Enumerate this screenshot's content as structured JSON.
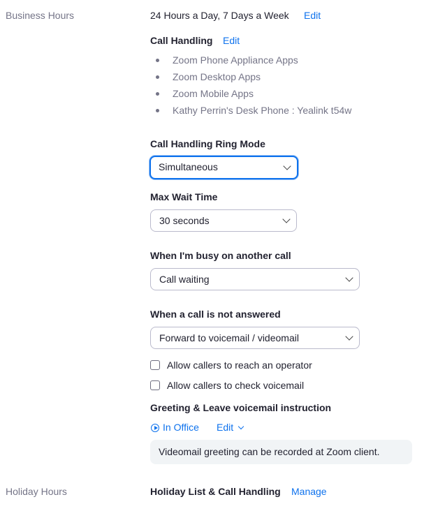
{
  "business_hours": {
    "section_label": "Business Hours",
    "schedule": "24 Hours a Day, 7 Days a Week",
    "edit_label": "Edit"
  },
  "call_handling": {
    "title": "Call Handling",
    "edit_label": "Edit",
    "devices": [
      "Zoom Phone Appliance Apps",
      "Zoom Desktop Apps",
      "Zoom Mobile Apps",
      "Kathy Perrin's Desk Phone : Yealink t54w"
    ]
  },
  "ring_mode": {
    "label": "Call Handling Ring Mode",
    "value": "Simultaneous"
  },
  "max_wait": {
    "label": "Max Wait Time",
    "value": "30 seconds"
  },
  "busy": {
    "label": "When I'm busy on another call",
    "value": "Call waiting"
  },
  "not_answered": {
    "label": "When a call is not answered",
    "value": "Forward to voicemail / videomail"
  },
  "options": {
    "reach_operator": {
      "label": "Allow callers to reach an operator",
      "checked": false
    },
    "check_voicemail": {
      "label": "Allow callers to check voicemail",
      "checked": false
    }
  },
  "greeting": {
    "title": "Greeting & Leave voicemail instruction",
    "in_office_label": "In Office",
    "edit_label": "Edit",
    "note": "Videomail greeting can be recorded at Zoom client."
  },
  "holiday_hours": {
    "section_label": "Holiday Hours",
    "title": "Holiday List & Call Handling",
    "manage_label": "Manage"
  },
  "colors": {
    "accent": "#0e72ed",
    "muted_text": "#747487",
    "text": "#222230",
    "note_bg": "#f1f4f6"
  }
}
